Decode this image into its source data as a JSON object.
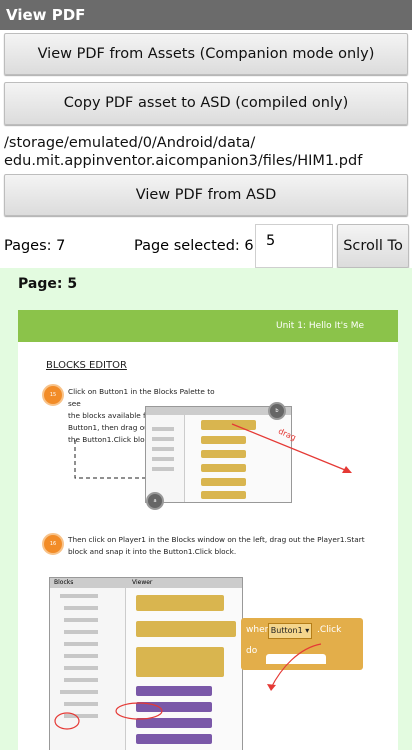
{
  "app": {
    "title": "View PDF"
  },
  "buttons": {
    "assets": "View PDF from Assets (Companion mode only)",
    "copy": "Copy PDF asset to ASD (compiled only)",
    "asd": "View PDF from ASD",
    "scroll": "Scroll To"
  },
  "path": {
    "line1": "/storage/emulated/0/Android/data/",
    "line2": "edu.mit.appinventor.aicompanion3/files/HIM1.pdf"
  },
  "pages": {
    "total": "Pages: 7",
    "selected": "Page selected: 6",
    "input_value": "5"
  },
  "viewer": {
    "page_label": "Page: 5",
    "header": "Unit 1: Hello It's Me",
    "section": "BLOCKS EDITOR",
    "step1_number": "15",
    "step1_line1": "Click on Button1 in the Blocks Palette to see",
    "step1_line2": "the blocks available for",
    "step1_line3": "Button1, then drag out",
    "step1_line4": "the Button1.Click block.",
    "step2_number": "16",
    "step2_line1": "Then click on Player1 in the Blocks window on the left, drag out the Player1.Start",
    "step2_line2": "block and snap it into the Button1.Click block.",
    "mark_a": "a",
    "mark_b": "b",
    "drag": "drag",
    "blocks_label": "Blocks",
    "viewer_label": "Viewer",
    "big_when": "when",
    "big_button": "Button1 ▾",
    "big_click": ".Click",
    "big_do": "do"
  }
}
